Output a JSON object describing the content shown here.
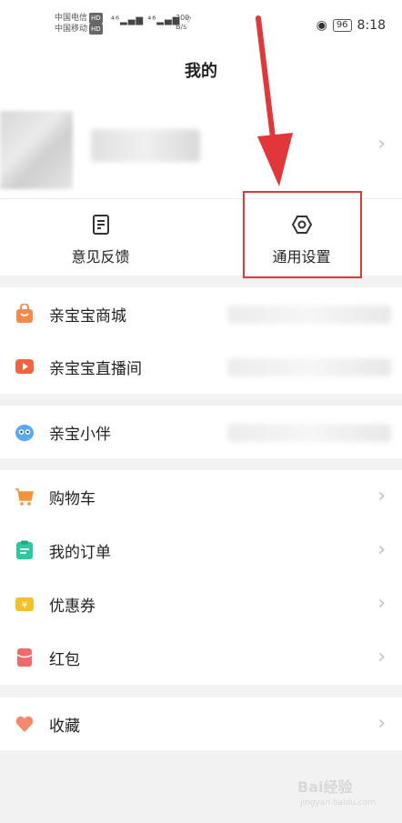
{
  "status_bar": {
    "carrier1": "中国电信",
    "carrier2": "中国移动",
    "hd": "HD",
    "speed_value": "200",
    "speed_unit": "B/s",
    "battery": "96",
    "time": "8:18"
  },
  "header": {
    "title": "我的"
  },
  "quick_actions": [
    {
      "label": "意见反馈",
      "icon": "feedback-icon"
    },
    {
      "label": "通用设置",
      "icon": "settings-hexagon-icon"
    }
  ],
  "section1": [
    {
      "label": "亲宝宝商城",
      "icon": "shopping-bag-icon",
      "color": "#f58a4a"
    },
    {
      "label": "亲宝宝直播间",
      "icon": "play-icon",
      "color": "#f4633f"
    }
  ],
  "section2": [
    {
      "label": "亲宝小伴",
      "icon": "owl-icon",
      "color": "#5aa8f0"
    }
  ],
  "section3": [
    {
      "label": "购物车",
      "icon": "cart-icon",
      "color": "#f5923e"
    },
    {
      "label": "我的订单",
      "icon": "order-icon",
      "color": "#2ec79e"
    },
    {
      "label": "优惠券",
      "icon": "coupon-icon",
      "color": "#f5c02a"
    },
    {
      "label": "红包",
      "icon": "red-packet-icon",
      "color": "#f06a6a"
    }
  ],
  "section4": [
    {
      "label": "收藏",
      "icon": "heart-icon",
      "color": "#f58a6a"
    }
  ],
  "chevron": "›",
  "watermark": {
    "brand": "Bai经验",
    "url": "jingyan.baidu.com"
  },
  "accent_color": "#e2373a"
}
